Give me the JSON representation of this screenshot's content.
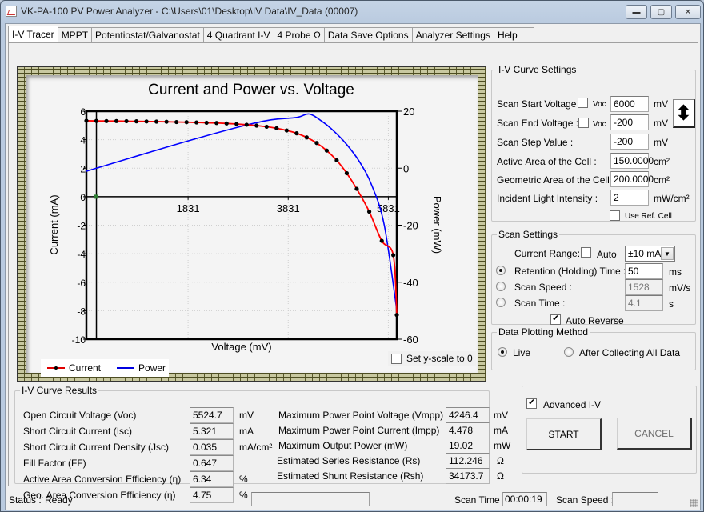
{
  "window": {
    "title": "VK-PA-100 PV Power Analyzer - C:\\Users\\01\\Desktop\\IV Data\\IV_Data (00007)",
    "icons": {
      "app": "app-chart-icon",
      "minimize": "minimize-icon",
      "maximize": "maximize-icon",
      "close": "close-icon"
    },
    "min_glyph": "▬",
    "max_glyph": "▢",
    "close_glyph": "✕"
  },
  "tabs": [
    {
      "label": "I-V Tracer",
      "active": true
    },
    {
      "label": "MPPT"
    },
    {
      "label": "Potentiostat/Galvanostat"
    },
    {
      "label": "4 Quadrant I-V"
    },
    {
      "label": "4 Probe Ω"
    },
    {
      "label": "Data Save Options"
    },
    {
      "label": "Analyzer Settings"
    },
    {
      "label": "Help"
    }
  ],
  "chart": {
    "legend": {
      "current": "Current",
      "power": "Power"
    },
    "set_y_scale_label": "Set y-scale to 0",
    "set_y_scale_checked": false
  },
  "chart_data": {
    "type": "line",
    "title": "Current and Power vs. Voltage",
    "xlabel": "Voltage (mV)",
    "ylabel": "Current (mA)",
    "y2label": "Power (mW)",
    "xlim": [
      -200,
      6000
    ],
    "ylim": [
      -10,
      6
    ],
    "y2lim": [
      -60,
      20
    ],
    "xticks": [
      1831,
      3831,
      5831
    ],
    "yticks": [
      6,
      4,
      2,
      0,
      -2,
      -4,
      -6,
      -8,
      -10
    ],
    "y2ticks": [
      20,
      0,
      -20,
      -40,
      -60
    ],
    "grid": true,
    "legend_position": "bottom-left",
    "colors": {
      "current": "#ff0000",
      "power": "#0000ff",
      "markers": "#000000"
    },
    "series": [
      {
        "name": "Current",
        "axis": "left",
        "x": [
          -200,
          0,
          200,
          400,
          600,
          800,
          1000,
          1200,
          1400,
          1600,
          1800,
          2000,
          2200,
          2400,
          2600,
          2800,
          3000,
          3200,
          3400,
          3600,
          3800,
          4000,
          4200,
          4400,
          4600,
          4800,
          5000,
          5200,
          5450,
          5700,
          5930,
          6000
        ],
        "y": [
          5.33,
          5.32,
          5.31,
          5.31,
          5.3,
          5.29,
          5.28,
          5.27,
          5.26,
          5.24,
          5.23,
          5.21,
          5.19,
          5.17,
          5.14,
          5.1,
          5.05,
          4.99,
          4.91,
          4.8,
          4.65,
          4.45,
          4.16,
          3.77,
          3.24,
          2.55,
          1.65,
          0.55,
          -1.05,
          -3.1,
          -4.1,
          -8.3
        ]
      },
      {
        "name": "Power",
        "axis": "right",
        "x": [
          -200,
          0,
          1000,
          2000,
          3000,
          3500,
          4000,
          4250,
          4500,
          4750,
          5000,
          5250,
          5500,
          5750,
          6000
        ],
        "y": [
          -1.07,
          0,
          5.28,
          10.42,
          15.15,
          17.0,
          17.8,
          19.02,
          16.5,
          12.9,
          8.3,
          2.4,
          -6.0,
          -20.0,
          -49.8
        ]
      }
    ],
    "origin_marker": {
      "x": 0,
      "y": 0,
      "color": "#2e7d32"
    }
  },
  "iv_settings": {
    "legend": "I-V Curve Settings",
    "rows": [
      {
        "label": "Scan Start Voltage :",
        "has_voc": true,
        "voc_label": "Voc",
        "voc_checked": false,
        "value": "6000",
        "unit": "mV"
      },
      {
        "label": "Scan End Voltage :",
        "has_voc": true,
        "voc_label": "Voc",
        "voc_checked": false,
        "value": "-200",
        "unit": "mV"
      },
      {
        "label": "Scan Step Value :",
        "value": "-200",
        "unit": "mV"
      },
      {
        "label": "Active Area of the Cell :",
        "value": "150.0000",
        "unit": "cm²"
      },
      {
        "label": "Geometric Area of the Cell :",
        "value": "200.0000",
        "unit": "cm²"
      },
      {
        "label": "Incident Light Intensity :",
        "value": "2",
        "unit": "mW/cm²"
      }
    ],
    "use_ref_cell_label": "Use Ref. Cell",
    "use_ref_cell_checked": false,
    "swap_icon": "swap-vertical-arrow-icon",
    "swap_glyph": "⬍"
  },
  "scan_settings": {
    "legend": "Scan Settings",
    "current_range_label": "Current Range:",
    "auto_label": "Auto",
    "auto_checked": false,
    "current_range_value": "±10 mA",
    "dropdown_glyph": "▼",
    "options": [
      {
        "label": "Retention (Holding) Time :",
        "value": "50",
        "unit": "ms",
        "selected": true,
        "enabled": true
      },
      {
        "label": "Scan Speed :",
        "value": "1528",
        "unit": "mV/s",
        "selected": false,
        "enabled": false
      },
      {
        "label": "Scan Time :",
        "value": "4.1",
        "unit": "s",
        "selected": false,
        "enabled": false
      }
    ],
    "auto_reverse_label": "Auto Reverse",
    "auto_reverse_checked": true
  },
  "plotting": {
    "legend": "Data Plotting Method",
    "live_label": "Live",
    "after_label": "After Collecting All Data",
    "selected": "live"
  },
  "results": {
    "legend": "I-V Curve Results",
    "left": [
      {
        "label": "Open Circuit Voltage (Voc)",
        "value": "5524.7",
        "unit": "mV"
      },
      {
        "label": "Short Circuit Current (Isc)",
        "value": "5.321",
        "unit": "mA"
      },
      {
        "label": "Short Circuit Current Density (Jsc)",
        "value": "0.035",
        "unit": "mA/cm²"
      },
      {
        "label": "Fill Factor (FF)",
        "value": "0.647",
        "unit": ""
      },
      {
        "label": "Active Area Conversion Efficiency (η)",
        "value": "6.34",
        "unit": "%"
      },
      {
        "label": "Geo. Area Conversion Efficiency (η)",
        "value": "4.75",
        "unit": "%"
      }
    ],
    "right": [
      {
        "label": "Maximum Power Point Voltage (Vmpp)",
        "value": "4246.4",
        "unit": "mV"
      },
      {
        "label": "Maximum Power Point Current (Impp)",
        "value": "4.478",
        "unit": "mA"
      },
      {
        "label": "Maximum Output Power (mW)",
        "value": "19.02",
        "unit": "mW"
      },
      {
        "label": "Estimated Series Resistance (Rs)",
        "value": "112.246",
        "unit": "Ω"
      },
      {
        "label": "Estimated Shunt Resistance (Rsh)",
        "value": "34173.7",
        "unit": "Ω"
      }
    ]
  },
  "controls": {
    "advanced_label": "Advanced I-V",
    "advanced_checked": true,
    "start_label": "START",
    "cancel_label": "CANCEL",
    "cancel_enabled": false
  },
  "status": {
    "status_label": "Status :",
    "status_value": "Ready",
    "progress": "",
    "scan_time_label": "Scan Time :",
    "scan_time_value": "00:00:19",
    "scan_speed_label": "Scan Speed :",
    "scan_speed_value": ""
  }
}
